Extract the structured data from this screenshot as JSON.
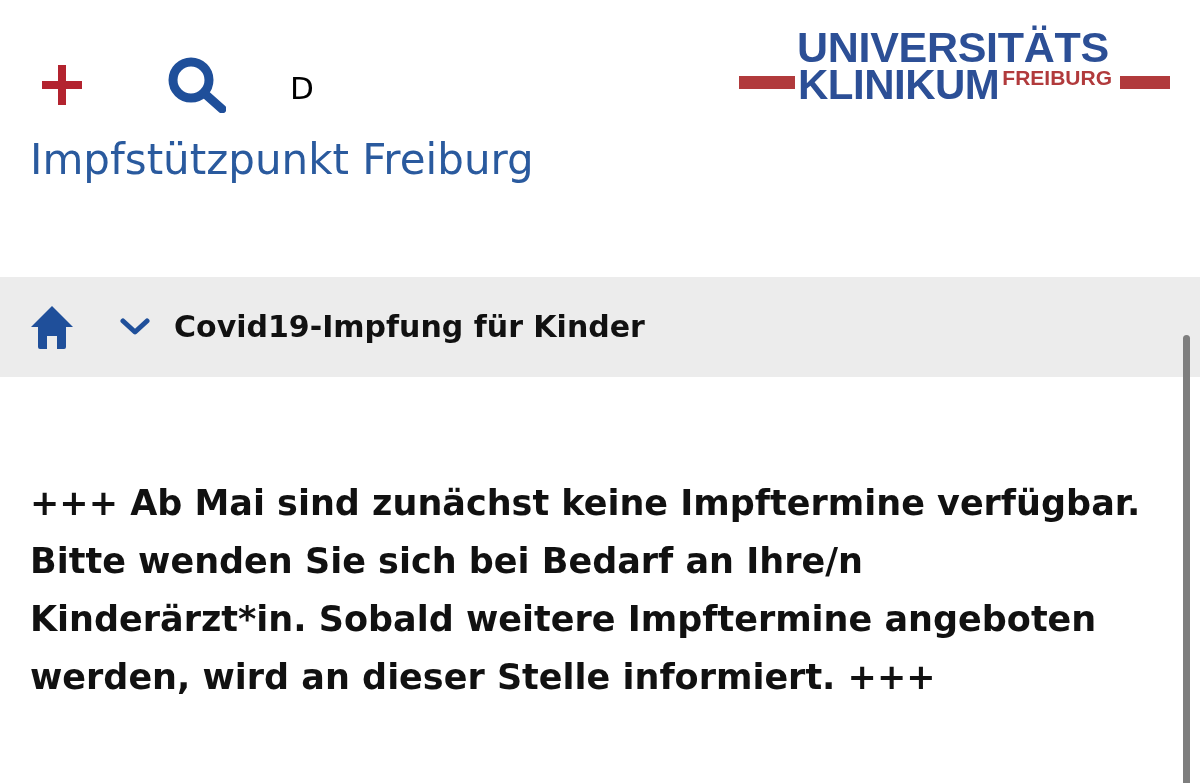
{
  "header": {
    "language": "D",
    "logo": {
      "line_1": "UNIVERSITÄTS",
      "line_2": "KLINIKUM",
      "line_3": "FREIBURG"
    }
  },
  "site_title": "Impfstützpunkt Freiburg",
  "breadcrumb": {
    "current": "Covid19-Impfung für Kinder"
  },
  "notice": {
    "lines": [
      "+++ Ab Mai sind zunächst keine Impftermine verfügbar.",
      "Bitte wenden Sie sich bei Bedarf an Ihre/n",
      "Kinderärzt*in. Sobald weitere Impftermine angeboten",
      "werden, wird an dieser Stelle informiert. +++"
    ]
  }
}
